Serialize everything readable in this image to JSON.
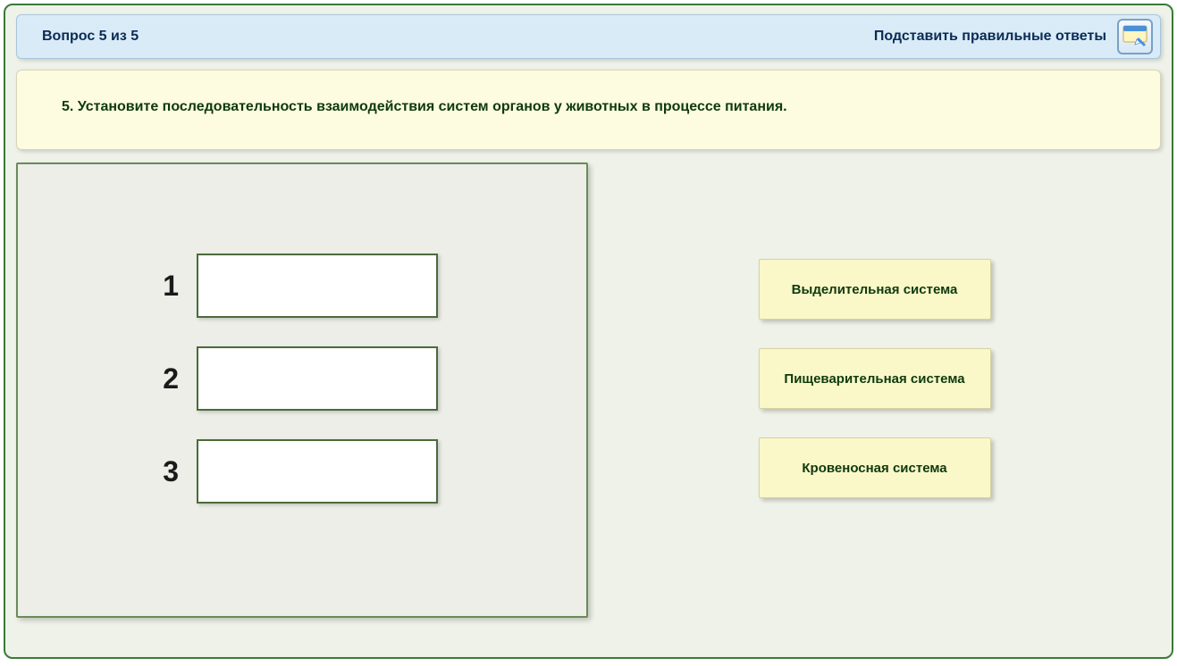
{
  "header": {
    "progress": "Вопрос 5 из 5",
    "hint_label": "Подставить правильные ответы"
  },
  "question": {
    "text": "5. Установите последовательность взаимодействия систем органов у животных в процессе питания."
  },
  "slots": [
    {
      "number": "1"
    },
    {
      "number": "2"
    },
    {
      "number": "3"
    }
  ],
  "options": [
    {
      "label": "Выделительная система"
    },
    {
      "label": "Пищеварительная система"
    },
    {
      "label": "Кровеносная система"
    }
  ]
}
